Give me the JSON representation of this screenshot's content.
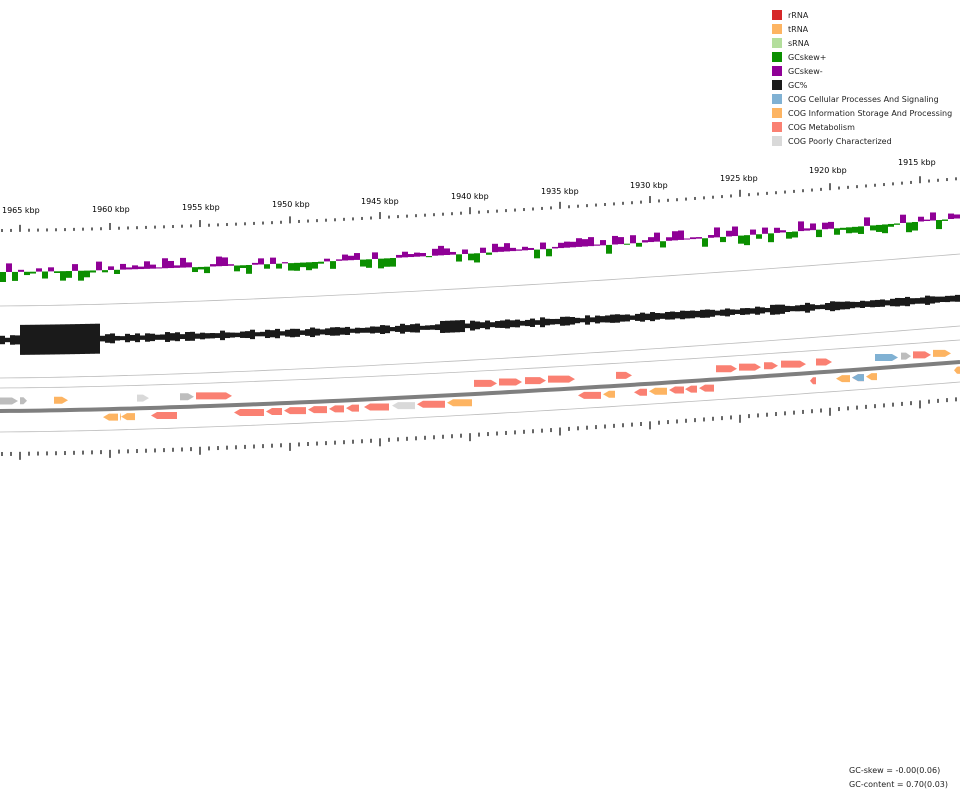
{
  "legend": [
    {
      "label": "rRNA",
      "color": "#d62728"
    },
    {
      "label": "tRNA",
      "color": "#fdb462"
    },
    {
      "label": "sRNA",
      "color": "#b3de9c"
    },
    {
      "label": "GCskew+",
      "color": "#0b8f00"
    },
    {
      "label": "GCskew-",
      "color": "#8f0096"
    },
    {
      "label": "GC%",
      "color": "#1a1a1a"
    },
    {
      "label": "COG Cellular Processes And Signaling",
      "color": "#80b1d3"
    },
    {
      "label": "COG Information Storage And Processing",
      "color": "#fdb462"
    },
    {
      "label": "COG Metabolism",
      "color": "#fa8072"
    },
    {
      "label": "COG Poorly Characterized",
      "color": "#d9d9d9"
    }
  ],
  "ruler": {
    "labels": [
      "1965 kbp",
      "1960 kbp",
      "1955 kbp",
      "1950 kbp",
      "1945 kbp",
      "1940 kbp",
      "1935 kbp",
      "1930 kbp",
      "1925 kbp",
      "1920 kbp",
      "1915 kbp"
    ]
  },
  "stats": {
    "gc_skew": "GC-skew = -0.00(0.06)",
    "gc_content": "GC-content = 0.70(0.03)"
  },
  "colors": {
    "cog_metabolism": "#fa8072",
    "cog_info": "#fdb462",
    "cog_cellular": "#80b1d3",
    "cog_poor": "#d9d9d9",
    "unclassified": "#bdbdbd",
    "skew_pos": "#0b8f00",
    "skew_neg": "#8f0096",
    "gc": "#1a1a1a",
    "backbone": "#7f7f7f"
  },
  "genes": {
    "forward": [
      {
        "cog": "unclassified"
      },
      {
        "cog": "unclassified"
      },
      {
        "cog": "info"
      },
      {
        "cog": "poor"
      },
      {
        "cog": "unclassified"
      },
      {
        "cog": "metabolism"
      },
      {
        "cog": "metabolism"
      },
      {
        "cog": "metabolism"
      },
      {
        "cog": "metabolism"
      },
      {
        "cog": "metabolism"
      },
      {
        "cog": "metabolism"
      },
      {
        "cog": "metabolism"
      },
      {
        "cog": "metabolism"
      },
      {
        "cog": "metabolism"
      },
      {
        "cog": "metabolism"
      },
      {
        "cog": "metabolism"
      },
      {
        "cog": "cellular"
      },
      {
        "cog": "unclassified"
      },
      {
        "cog": "metabolism"
      },
      {
        "cog": "info"
      }
    ],
    "reverse": [
      {
        "cog": "info"
      },
      {
        "cog": "info"
      },
      {
        "cog": "info"
      },
      {
        "cog": "info"
      },
      {
        "cog": "info"
      },
      {
        "cog": "metabolism"
      },
      {
        "cog": "metabolism"
      },
      {
        "cog": "metabolism"
      },
      {
        "cog": "metabolism"
      },
      {
        "cog": "metabolism"
      },
      {
        "cog": "metabolism"
      },
      {
        "cog": "metabolism"
      },
      {
        "cog": "metabolism"
      },
      {
        "cog": "metabolism"
      },
      {
        "cog": "poor"
      },
      {
        "cog": "metabolism"
      },
      {
        "cog": "info"
      },
      {
        "cog": "metabolism"
      },
      {
        "cog": "info"
      },
      {
        "cog": "metabolism"
      },
      {
        "cog": "metabolism"
      },
      {
        "cog": "metabolism"
      },
      {
        "cog": "metabolism"
      },
      {
        "cog": "metabolism"
      },
      {
        "cog": "metabolism"
      },
      {
        "cog": "info"
      },
      {
        "cog": "cellular"
      },
      {
        "cog": "info"
      }
    ]
  }
}
